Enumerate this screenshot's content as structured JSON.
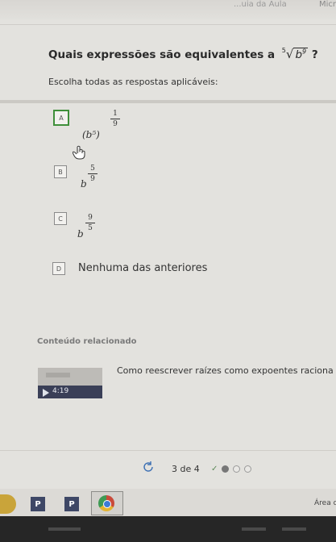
{
  "browser": {
    "top_text": "...uia da Aula",
    "micro_text": "Micr"
  },
  "question": {
    "text": "Quais expressões são equivalentes a",
    "root_index": "5",
    "root_base": "b",
    "root_exp": "9",
    "tail": "?"
  },
  "instruction": "Escolha todas as respostas aplicáveis:",
  "options": [
    {
      "letter": "A",
      "selected": true,
      "expr": "(b⁵)",
      "frac_n": "1",
      "frac_d": "9"
    },
    {
      "letter": "B",
      "selected": false,
      "expr": "b",
      "frac_n": "5",
      "frac_d": "9"
    },
    {
      "letter": "C",
      "selected": false,
      "expr": "b",
      "frac_n": "9",
      "frac_d": "5"
    },
    {
      "letter": "D",
      "selected": false,
      "text": "Nenhuma das anteriores"
    }
  ],
  "related": {
    "title": "Conteúdo relacionado",
    "video_duration": "4:19",
    "video_title": "Como reescrever raízes como expoentes raciona"
  },
  "footer": {
    "progress": "3 de 4",
    "completed_icon": "check-icon"
  },
  "taskbar": {
    "btn1": "P",
    "btn2": "P",
    "area_text": "Área d"
  },
  "colors": {
    "selected_border": "#3f8f3a",
    "thumb_strip": "#3a3f57"
  }
}
